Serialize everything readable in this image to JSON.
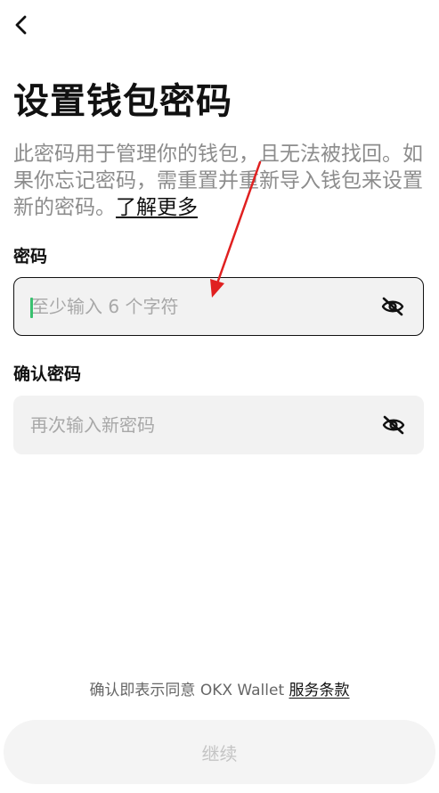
{
  "header": {
    "back_icon": "chevron-left-icon"
  },
  "page": {
    "title": "设置钱包密码",
    "description": "此密码用于管理你的钱包，且无法被找回。如果你忘记密码，需重置并重新导入钱包来设置新的密码。",
    "learn_more": "了解更多"
  },
  "form": {
    "password": {
      "label": "密码",
      "placeholder": "至少输入 6 个字符",
      "value": "",
      "visibility_icon": "eye-off-icon"
    },
    "confirm": {
      "label": "确认密码",
      "placeholder": "再次输入新密码",
      "value": "",
      "visibility_icon": "eye-off-icon"
    }
  },
  "footer": {
    "terms_prefix": "确认即表示同意 OKX Wallet ",
    "terms_link": "服务条款",
    "continue_label": "继续"
  },
  "colors": {
    "annotation_arrow": "#e02020",
    "cursor": "#39c16f",
    "input_background": "#f2f2f2",
    "disabled_text": "#c4c4c4"
  }
}
